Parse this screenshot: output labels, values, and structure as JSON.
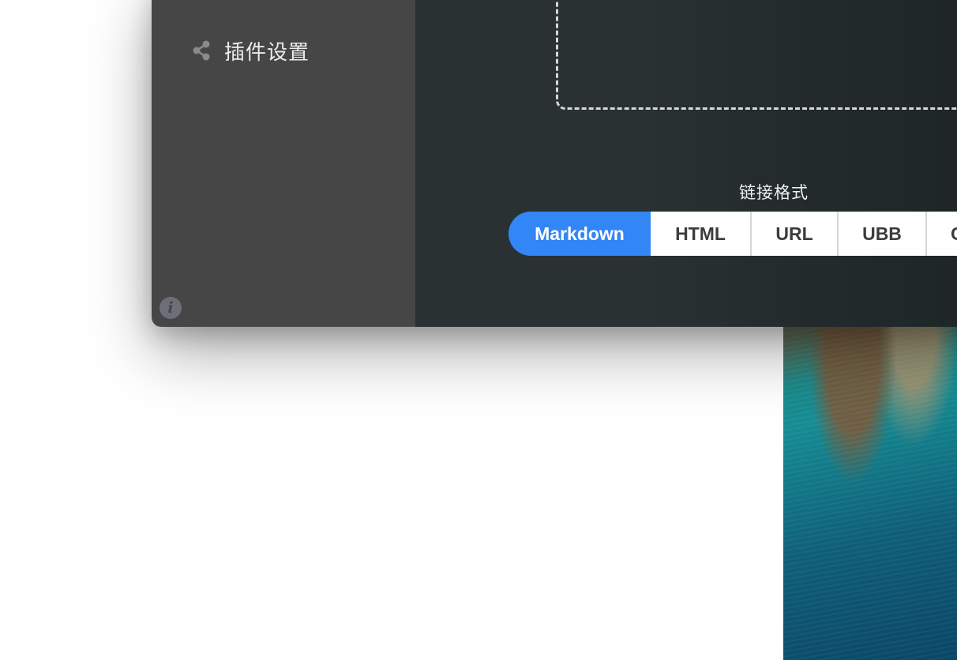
{
  "sidebar": {
    "items": [
      {
        "label": "插件设置",
        "icon": "share-icon"
      }
    ],
    "footer_icon": "info-icon",
    "footer_icon_glyph": "i"
  },
  "main": {
    "drop_zone": {
      "style": "dashed"
    },
    "link_format": {
      "title": "链接格式",
      "options": [
        {
          "label": "Markdown",
          "selected": true
        },
        {
          "label": "HTML",
          "selected": false
        },
        {
          "label": "URL",
          "selected": false
        },
        {
          "label": "UBB",
          "selected": false
        },
        {
          "label": "C",
          "selected": false
        }
      ]
    }
  },
  "colors": {
    "sidebar_bg": "#464646",
    "main_bg": "#293133",
    "accent": "#3286f5",
    "segment_bg": "#ffffff",
    "segment_text": "#3c3c3c"
  }
}
